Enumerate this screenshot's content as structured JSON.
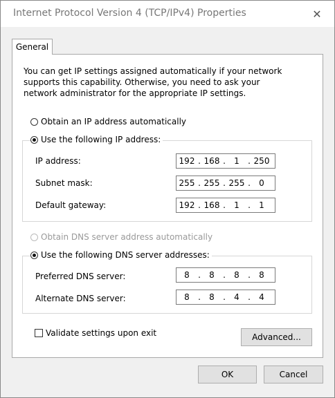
{
  "window": {
    "title": "Internet Protocol Version 4 (TCP/IPv4) Properties",
    "close_glyph": "✕"
  },
  "tabs": [
    {
      "label": "General"
    }
  ],
  "general": {
    "description": "You can get IP settings assigned automatically if your network supports this capability. Otherwise, you need to ask your network administrator for the appropriate IP settings.",
    "ip_mode": {
      "auto_label": "Obtain an IP address automatically",
      "manual_label": "Use the following IP address:",
      "selected": "manual"
    },
    "ip_fields": {
      "ip_address": {
        "label": "IP address:",
        "octets": [
          "192",
          "168",
          "1",
          "250"
        ]
      },
      "subnet_mask": {
        "label": "Subnet mask:",
        "octets": [
          "255",
          "255",
          "255",
          "0"
        ]
      },
      "default_gateway": {
        "label": "Default gateway:",
        "octets": [
          "192",
          "168",
          "1",
          "1"
        ]
      }
    },
    "dns_mode": {
      "auto_label": "Obtain DNS server address automatically",
      "auto_enabled": false,
      "manual_label": "Use the following DNS server addresses:",
      "selected": "manual"
    },
    "dns_fields": {
      "preferred": {
        "label": "Preferred DNS server:",
        "octets": [
          "8",
          "8",
          "8",
          "8"
        ]
      },
      "alternate": {
        "label": "Alternate DNS server:",
        "octets": [
          "8",
          "8",
          "4",
          "4"
        ]
      }
    },
    "validate": {
      "label": "Validate settings upon exit",
      "checked": false
    },
    "advanced_label": "Advanced..."
  },
  "footer": {
    "ok_label": "OK",
    "cancel_label": "Cancel"
  },
  "icons": {
    "close": "close-icon",
    "radio": "radio-button",
    "checkbox": "checkbox"
  },
  "colors": {
    "window_bg": "#f0f0f0",
    "panel_bg": "#ffffff",
    "title_text": "#777777",
    "disabled_text": "#999999"
  }
}
